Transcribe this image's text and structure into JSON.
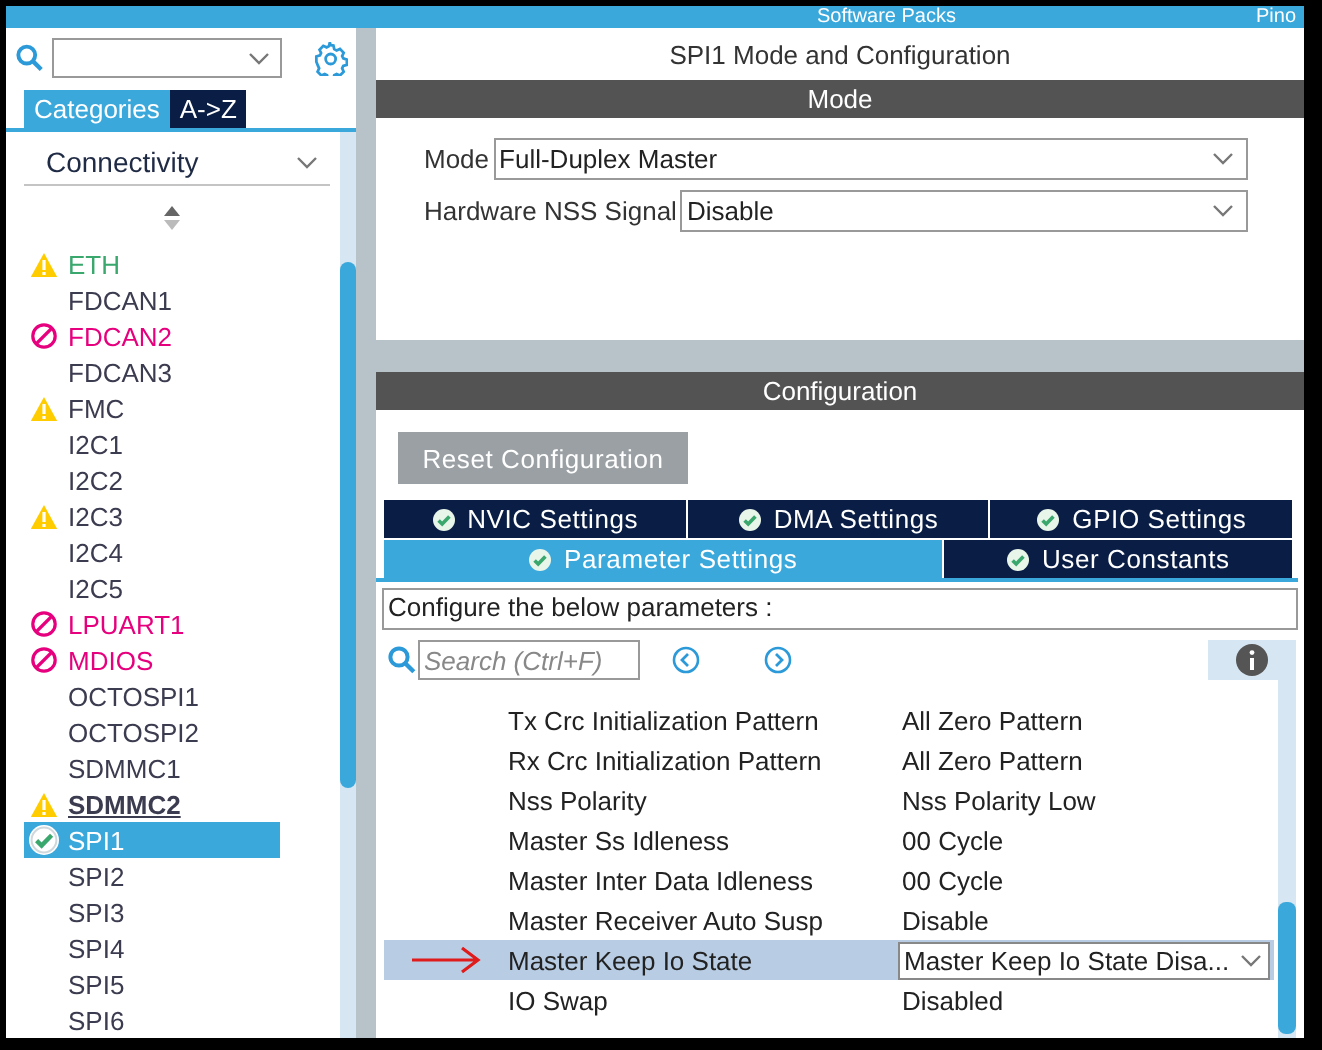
{
  "top_bar": {
    "items": [
      "Software Packs",
      "Pino"
    ]
  },
  "sidebar": {
    "tabs": [
      {
        "label": "Categories",
        "selected": true
      },
      {
        "label": "A->Z",
        "selected": false
      }
    ],
    "category": "Connectivity",
    "items": [
      {
        "label": "ETH",
        "kind": "warning",
        "color": "#3aa76d",
        "bold": false,
        "selected": false
      },
      {
        "label": "FDCAN1",
        "kind": "plain",
        "color": "#3c3c50",
        "bold": false,
        "selected": false
      },
      {
        "label": "FDCAN2",
        "kind": "blocked",
        "color": "#e6007e",
        "bold": false,
        "selected": false
      },
      {
        "label": "FDCAN3",
        "kind": "plain",
        "color": "#3c3c50",
        "bold": false,
        "selected": false
      },
      {
        "label": "FMC",
        "kind": "warning",
        "color": "#3c3c50",
        "bold": false,
        "selected": false
      },
      {
        "label": "I2C1",
        "kind": "plain",
        "color": "#3c3c50",
        "bold": false,
        "selected": false
      },
      {
        "label": "I2C2",
        "kind": "plain",
        "color": "#3c3c50",
        "bold": false,
        "selected": false
      },
      {
        "label": "I2C3",
        "kind": "warning",
        "color": "#3c3c50",
        "bold": false,
        "selected": false
      },
      {
        "label": "I2C4",
        "kind": "plain",
        "color": "#3c3c50",
        "bold": false,
        "selected": false
      },
      {
        "label": "I2C5",
        "kind": "plain",
        "color": "#3c3c50",
        "bold": false,
        "selected": false
      },
      {
        "label": "LPUART1",
        "kind": "blocked",
        "color": "#e6007e",
        "bold": false,
        "selected": false
      },
      {
        "label": "MDIOS",
        "kind": "blocked",
        "color": "#e6007e",
        "bold": false,
        "selected": false
      },
      {
        "label": "OCTOSPI1",
        "kind": "plain",
        "color": "#3c3c50",
        "bold": false,
        "selected": false
      },
      {
        "label": "OCTOSPI2",
        "kind": "plain",
        "color": "#3c3c50",
        "bold": false,
        "selected": false
      },
      {
        "label": "SDMMC1",
        "kind": "plain",
        "color": "#3c3c50",
        "bold": false,
        "selected": false
      },
      {
        "label": "SDMMC2",
        "kind": "warning",
        "color": "#3c3c50",
        "bold": true,
        "selected": false
      },
      {
        "label": "SPI1",
        "kind": "ok",
        "color": "#ffffff",
        "bold": false,
        "selected": true
      },
      {
        "label": "SPI2",
        "kind": "plain",
        "color": "#3c3c50",
        "bold": false,
        "selected": false
      },
      {
        "label": "SPI3",
        "kind": "plain",
        "color": "#3c3c50",
        "bold": false,
        "selected": false
      },
      {
        "label": "SPI4",
        "kind": "plain",
        "color": "#3c3c50",
        "bold": false,
        "selected": false
      },
      {
        "label": "SPI5",
        "kind": "plain",
        "color": "#3c3c50",
        "bold": false,
        "selected": false
      },
      {
        "label": "SPI6",
        "kind": "plain",
        "color": "#3c3c50",
        "bold": false,
        "selected": false
      }
    ]
  },
  "panel": {
    "title": "SPI1 Mode and Configuration",
    "mode": {
      "header": "Mode",
      "fields": [
        {
          "label": "Mode",
          "value": "Full-Duplex Master"
        },
        {
          "label": "Hardware NSS Signal",
          "value": "Disable"
        }
      ]
    },
    "configuration": {
      "header": "Configuration",
      "reset_button": "Reset Configuration",
      "tab_rows": [
        [
          {
            "label": "NVIC Settings",
            "selected": false
          },
          {
            "label": "DMA Settings",
            "selected": false
          },
          {
            "label": "GPIO Settings",
            "selected": false
          }
        ],
        [
          {
            "label": "Parameter Settings",
            "selected": true
          },
          {
            "label": "User Constants",
            "selected": false
          }
        ]
      ],
      "hint": "Configure the below parameters :",
      "search": {
        "placeholder": "Search (Ctrl+F)"
      },
      "parameters": [
        {
          "name": "Tx Crc Initialization Pattern",
          "value": "All Zero Pattern",
          "kind": "text",
          "selected": false
        },
        {
          "name": "Rx Crc Initialization Pattern",
          "value": "All Zero Pattern",
          "kind": "text",
          "selected": false
        },
        {
          "name": "Nss Polarity",
          "value": "Nss Polarity Low",
          "kind": "text",
          "selected": false
        },
        {
          "name": "Master Ss Idleness",
          "value": "00 Cycle",
          "kind": "text",
          "selected": false
        },
        {
          "name": "Master Inter Data Idleness",
          "value": "00 Cycle",
          "kind": "text",
          "selected": false
        },
        {
          "name": "Master Receiver Auto Susp",
          "value": "Disable",
          "kind": "text",
          "selected": false
        },
        {
          "name": "Master Keep Io State",
          "value": "Master Keep Io State Disa...",
          "kind": "dropdown",
          "selected": true
        },
        {
          "name": "IO Swap",
          "value": "Disabled",
          "kind": "text",
          "selected": false
        }
      ]
    }
  }
}
